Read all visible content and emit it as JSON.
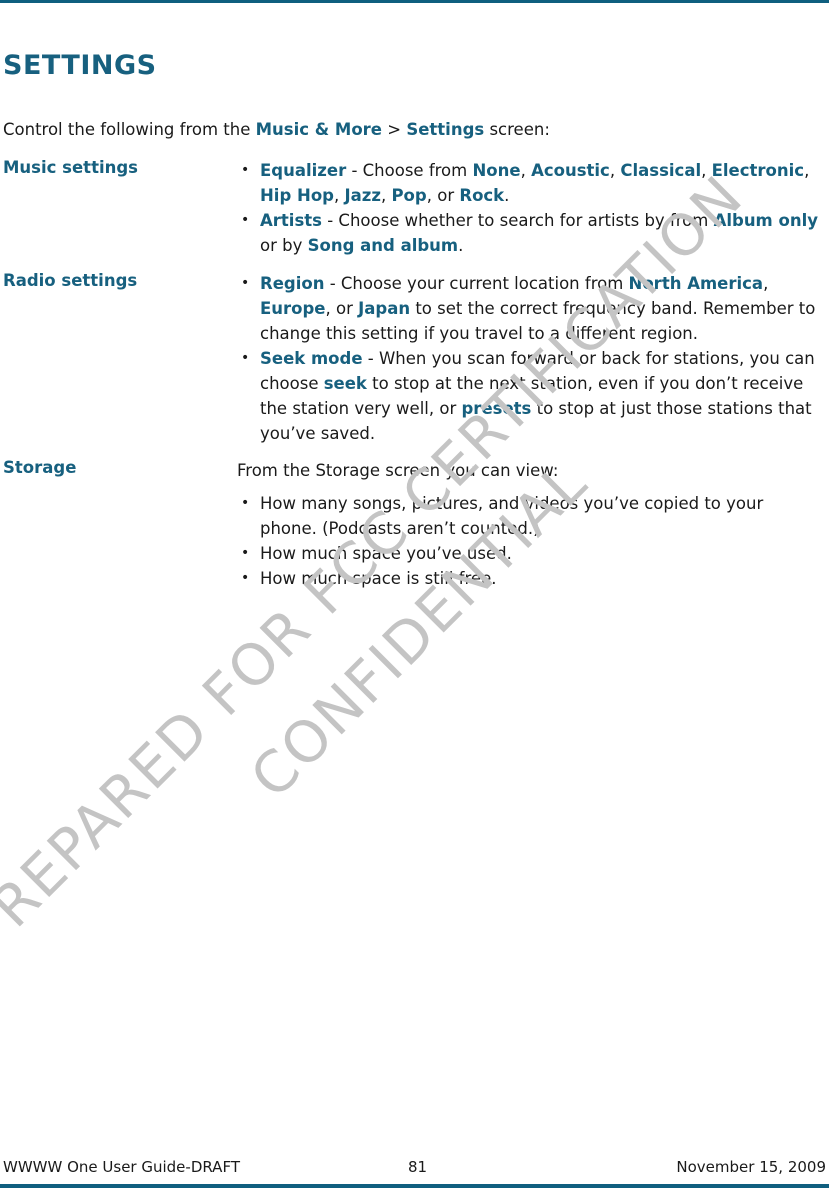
{
  "page": {
    "title": "SETTINGS",
    "intro": {
      "prefix": "Control the following from the ",
      "link1": "Music & More",
      "separator": " > ",
      "link2": "Settings",
      "suffix": " screen:"
    },
    "sections": [
      {
        "label": "Music settings",
        "bullets": [
          {
            "term": "Equalizer",
            "text_a": " - Choose from ",
            "options": [
              "None",
              "Acoustic",
              "Classical",
              "Electronic",
              "Hip Hop",
              "Jazz",
              "Pop",
              "Rock"
            ],
            "conj": "or"
          },
          {
            "term": "Artists",
            "text_a": " - Choose whether to search for artists by from ",
            "opt1": "Album only",
            "text_b": " or by ",
            "opt2": "Song and album",
            "end": "."
          }
        ]
      },
      {
        "label": "Radio settings",
        "bullets": [
          {
            "term": "Region",
            "text_a": " - Choose your current location from ",
            "opt1": "North America",
            "sep1": ", ",
            "opt2": "Europe",
            "sep2": ", or ",
            "opt3": "Japan",
            "text_b": " to set the correct frequency band. Remember to change this setting if you travel to a different region."
          },
          {
            "term": "Seek mode",
            "text_a": " - When you scan forward or back for stations, you can choose ",
            "opt1": "seek",
            "text_b": " to stop at the next station, even if you don’t receive the station very well, or ",
            "opt2": "presets",
            "text_c": " to stop at just those stations that you’ve saved."
          }
        ]
      },
      {
        "label": "Storage",
        "intro": "From the Storage screen you can view:",
        "bullets": [
          "How many songs, pictures, and videos you’ve copied to your phone. (Podcasts aren’t counted.)",
          "How much space you’ve used.",
          "How much space is still free."
        ]
      }
    ]
  },
  "bullet_glyph": "•",
  "footer": {
    "doc_title": "WWWW One User Guide-DRAFT",
    "page_number": "81",
    "date": "November 15, 2009"
  },
  "watermark": {
    "line1": "PREPARED FOR FCC CERTIFICATION",
    "line2": "CONFIDENTIAL"
  },
  "colors": {
    "accent": "#17607f",
    "rule": "#0f5f7f",
    "watermark": "#c4c4c4"
  }
}
